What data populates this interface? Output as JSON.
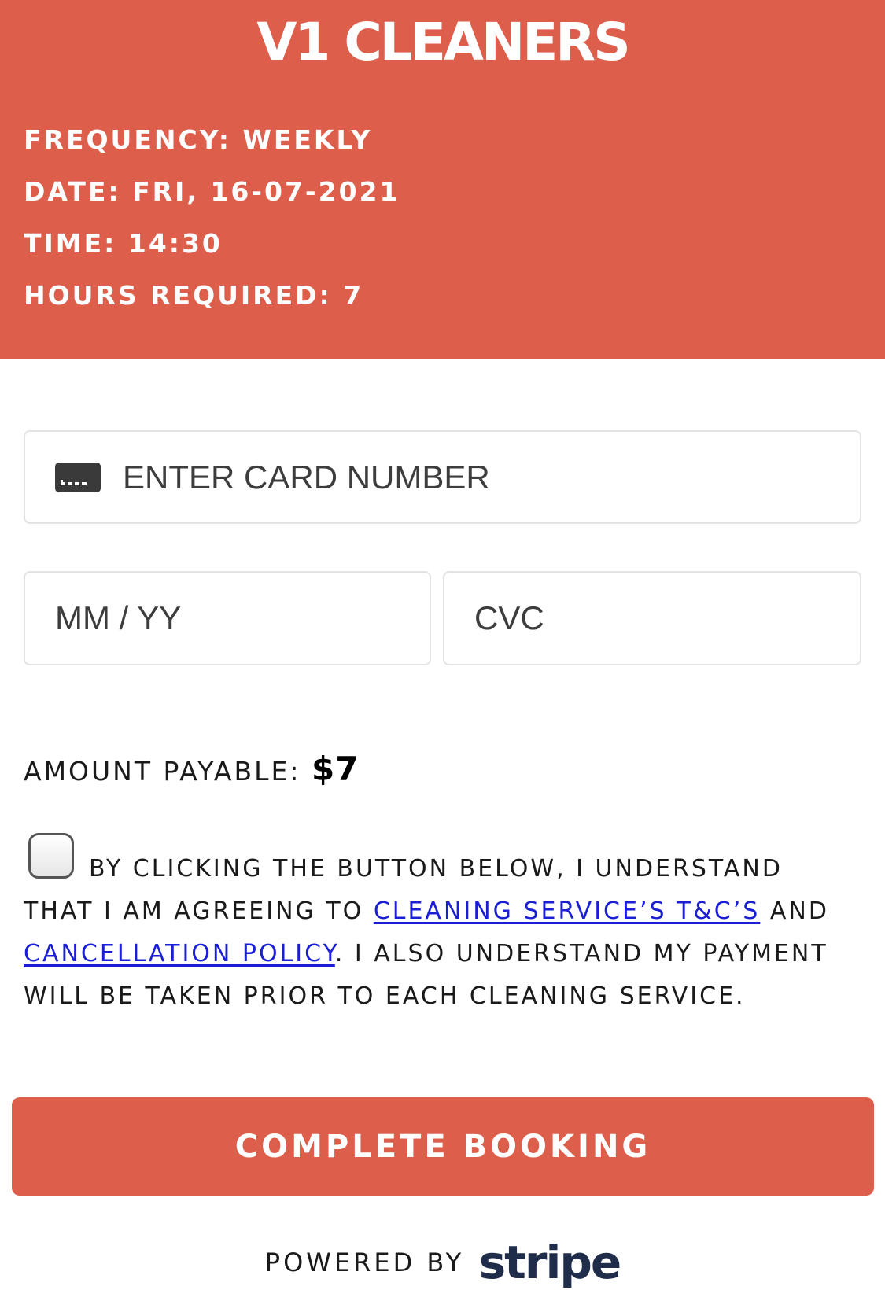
{
  "brand": "V1 CLEANERS",
  "booking": {
    "frequency": "FREQUENCY: WEEKLY",
    "date": "DATE: FRI, 16-07-2021",
    "time": "TIME: 14:30",
    "hours": "HOURS REQUIRED: 7"
  },
  "payment": {
    "card_placeholder": "ENTER CARD NUMBER",
    "expiry_placeholder": "MM / YY",
    "cvc_placeholder": "CVC",
    "card_icon": "credit-card-icon"
  },
  "amount": {
    "label": "AMOUNT PAYABLE: ",
    "value": "$7"
  },
  "consent": {
    "checked": false,
    "line1": "BY CLICKING THE BUTTON BELOW, I UNDERSTAND",
    "line2_prefix": "THAT I AM AGREEING TO ",
    "terms_link": "CLEANING SERVICE’S T&C’S",
    "line2_suffix": " AND",
    "cancellation_link": "CANCELLATION POLICY",
    "line3_suffix": ". I ALSO UNDERSTAND MY PAYMENT",
    "line4": "WILL BE TAKEN PRIOR TO EACH CLEANING SERVICE."
  },
  "button": {
    "label": "COMPLETE BOOKING"
  },
  "footer": {
    "powered_by": "POWERED BY",
    "provider": "stripe"
  },
  "colors": {
    "accent": "#dd5f4b",
    "link": "#1a1fd6",
    "stripe_navy": "#1f2c4a"
  }
}
